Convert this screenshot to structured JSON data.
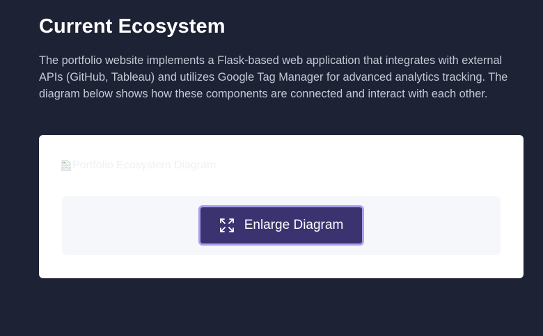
{
  "section": {
    "title": "Current Ecosystem",
    "description": "The portfolio website implements a Flask-based web application that integrates with external APIs (GitHub, Tableau) and utilizes Google Tag Manager for advanced analytics tracking. The diagram below shows how these components are connected and interact with each other."
  },
  "diagram": {
    "alt_text": "Portfolio Ecosystem Diagram",
    "broken_image_icon": "broken-image-icon"
  },
  "controls": {
    "enlarge_label": "Enlarge Diagram",
    "enlarge_icon": "expand-icon"
  },
  "colors": {
    "page_background": "#1e2235",
    "card_background": "#ffffff",
    "button_background": "#3a3370",
    "button_border": "#a9a0ec"
  }
}
